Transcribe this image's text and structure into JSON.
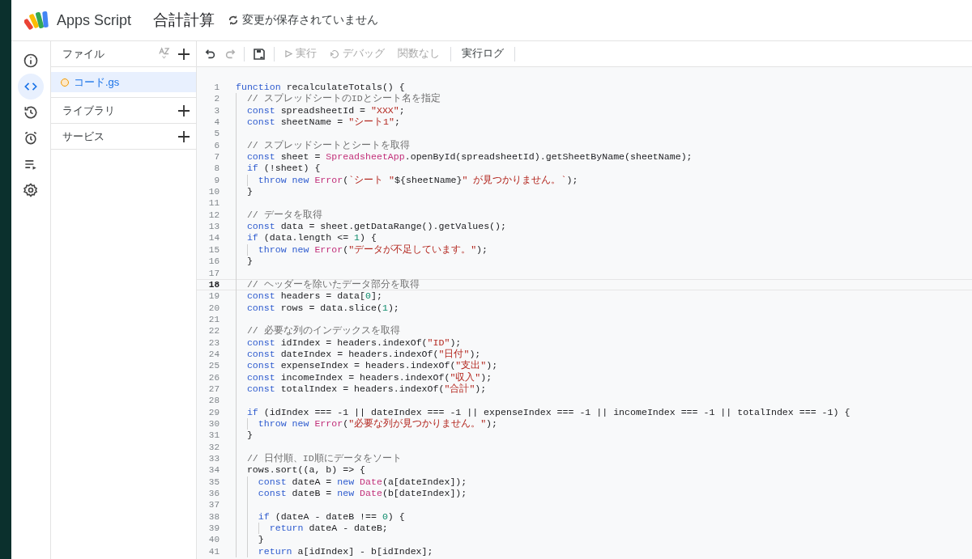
{
  "header": {
    "product": "Apps Script",
    "project": "合計計算",
    "status": "変更が保存されていません"
  },
  "rail": [
    {
      "kind": "info",
      "selected": false
    },
    {
      "kind": "code",
      "selected": true
    },
    {
      "kind": "history",
      "selected": false
    },
    {
      "kind": "alarm",
      "selected": false
    },
    {
      "kind": "executions",
      "selected": false
    },
    {
      "kind": "settings",
      "selected": false
    }
  ],
  "files_panel": {
    "title": "ファイル",
    "files": [
      {
        "name": "コード.gs",
        "selected": true,
        "unsaved": true
      }
    ],
    "sections": [
      "ライブラリ",
      "サービス"
    ]
  },
  "toolbar": [
    {
      "kind": "undo",
      "disabled": false
    },
    {
      "kind": "redo",
      "disabled": true
    },
    {
      "kind": "divider"
    },
    {
      "kind": "save",
      "disabled": false
    },
    {
      "kind": "divider"
    },
    {
      "kind": "run",
      "label": "実行",
      "disabled": true
    },
    {
      "kind": "debug",
      "label": "デバッグ",
      "disabled": true
    },
    {
      "kind": "select",
      "label": "関数なし",
      "disabled": true
    },
    {
      "kind": "divider"
    },
    {
      "kind": "text",
      "label": "実行ログ",
      "disabled": false
    },
    {
      "kind": "divider"
    }
  ],
  "code": [
    {
      "num": "1",
      "current": false,
      "tokens": [
        {
          "kind": "keyword",
          "text": "function"
        },
        {
          "kind": "plain",
          "text": " recalculateTotals() {"
        }
      ]
    },
    {
      "num": "2",
      "current": false,
      "tokens": [
        {
          "kind": "indent"
        },
        {
          "kind": "comment",
          "text": "// スプレッドシートのIDとシート名を指定"
        }
      ]
    },
    {
      "num": "3",
      "current": false,
      "tokens": [
        {
          "kind": "indent"
        },
        {
          "kind": "keyword",
          "text": "const"
        },
        {
          "kind": "plain",
          "text": " spreadsheetId = "
        },
        {
          "kind": "string",
          "text": "\"XXX\""
        },
        {
          "kind": "plain",
          "text": ";"
        }
      ]
    },
    {
      "num": "4",
      "current": false,
      "tokens": [
        {
          "kind": "indent"
        },
        {
          "kind": "keyword",
          "text": "const"
        },
        {
          "kind": "plain",
          "text": " sheetName = "
        },
        {
          "kind": "string",
          "text": "\"シート1\""
        },
        {
          "kind": "plain",
          "text": ";"
        }
      ]
    },
    {
      "num": "5",
      "current": false,
      "tokens": [
        {
          "kind": "indent"
        }
      ]
    },
    {
      "num": "6",
      "current": false,
      "tokens": [
        {
          "kind": "indent"
        },
        {
          "kind": "comment",
          "text": "// スプレッドシートとシートを取得"
        }
      ]
    },
    {
      "num": "7",
      "current": false,
      "tokens": [
        {
          "kind": "indent"
        },
        {
          "kind": "keyword",
          "text": "const"
        },
        {
          "kind": "plain",
          "text": " sheet = "
        },
        {
          "kind": "type",
          "text": "SpreadsheetApp"
        },
        {
          "kind": "plain",
          "text": ".openById(spreadsheetId).getSheetByName(sheetName);"
        }
      ]
    },
    {
      "num": "8",
      "current": false,
      "tokens": [
        {
          "kind": "indent"
        },
        {
          "kind": "keyword",
          "text": "if"
        },
        {
          "kind": "plain",
          "text": " (!sheet) {"
        }
      ]
    },
    {
      "num": "9",
      "current": false,
      "tokens": [
        {
          "kind": "indent"
        },
        {
          "kind": "indent"
        },
        {
          "kind": "keyword",
          "text": "throw"
        },
        {
          "kind": "keyword",
          "text": " new"
        },
        {
          "kind": "type",
          "text": " Error"
        },
        {
          "kind": "plain",
          "text": "("
        },
        {
          "kind": "string",
          "text": "`シート \""
        },
        {
          "kind": "plain",
          "text": "${sheetName}"
        },
        {
          "kind": "string",
          "text": "\" が見つかりません。`"
        },
        {
          "kind": "plain",
          "text": ");"
        }
      ]
    },
    {
      "num": "10",
      "current": false,
      "tokens": [
        {
          "kind": "indent"
        },
        {
          "kind": "plain",
          "text": "}"
        }
      ]
    },
    {
      "num": "11",
      "current": false,
      "tokens": [
        {
          "kind": "indent"
        }
      ]
    },
    {
      "num": "12",
      "current": false,
      "tokens": [
        {
          "kind": "indent"
        },
        {
          "kind": "comment",
          "text": "// データを取得"
        }
      ]
    },
    {
      "num": "13",
      "current": false,
      "tokens": [
        {
          "kind": "indent"
        },
        {
          "kind": "keyword",
          "text": "const"
        },
        {
          "kind": "plain",
          "text": " data = sheet.getDataRange().getValues();"
        }
      ]
    },
    {
      "num": "14",
      "current": false,
      "tokens": [
        {
          "kind": "indent"
        },
        {
          "kind": "keyword",
          "text": "if"
        },
        {
          "kind": "plain",
          "text": " (data.length <= "
        },
        {
          "kind": "number",
          "text": "1"
        },
        {
          "kind": "plain",
          "text": ") {"
        }
      ]
    },
    {
      "num": "15",
      "current": false,
      "tokens": [
        {
          "kind": "indent"
        },
        {
          "kind": "indent"
        },
        {
          "kind": "keyword",
          "text": "throw"
        },
        {
          "kind": "keyword",
          "text": " new"
        },
        {
          "kind": "type",
          "text": " Error"
        },
        {
          "kind": "plain",
          "text": "("
        },
        {
          "kind": "string",
          "text": "\"データが不足しています。\""
        },
        {
          "kind": "plain",
          "text": ");"
        }
      ]
    },
    {
      "num": "16",
      "current": false,
      "tokens": [
        {
          "kind": "indent"
        },
        {
          "kind": "plain",
          "text": "}"
        }
      ]
    },
    {
      "num": "17",
      "current": false,
      "tokens": [
        {
          "kind": "indent"
        }
      ]
    },
    {
      "num": "18",
      "current": true,
      "tokens": [
        {
          "kind": "indent"
        },
        {
          "kind": "comment",
          "text": "// ヘッダーを除いたデータ部分を取得"
        }
      ]
    },
    {
      "num": "19",
      "current": false,
      "tokens": [
        {
          "kind": "indent"
        },
        {
          "kind": "keyword",
          "text": "const"
        },
        {
          "kind": "plain",
          "text": " headers = data["
        },
        {
          "kind": "number",
          "text": "0"
        },
        {
          "kind": "plain",
          "text": "];"
        }
      ]
    },
    {
      "num": "20",
      "current": false,
      "tokens": [
        {
          "kind": "indent"
        },
        {
          "kind": "keyword",
          "text": "const"
        },
        {
          "kind": "plain",
          "text": " rows = data.slice("
        },
        {
          "kind": "number",
          "text": "1"
        },
        {
          "kind": "plain",
          "text": ");"
        }
      ]
    },
    {
      "num": "21",
      "current": false,
      "tokens": [
        {
          "kind": "indent"
        }
      ]
    },
    {
      "num": "22",
      "current": false,
      "tokens": [
        {
          "kind": "indent"
        },
        {
          "kind": "comment",
          "text": "// 必要な列のインデックスを取得"
        }
      ]
    },
    {
      "num": "23",
      "current": false,
      "tokens": [
        {
          "kind": "indent"
        },
        {
          "kind": "keyword",
          "text": "const"
        },
        {
          "kind": "plain",
          "text": " idIndex = headers.indexOf("
        },
        {
          "kind": "string",
          "text": "\"ID\""
        },
        {
          "kind": "plain",
          "text": ");"
        }
      ]
    },
    {
      "num": "24",
      "current": false,
      "tokens": [
        {
          "kind": "indent"
        },
        {
          "kind": "keyword",
          "text": "const"
        },
        {
          "kind": "plain",
          "text": " dateIndex = headers.indexOf("
        },
        {
          "kind": "string",
          "text": "\"日付\""
        },
        {
          "kind": "plain",
          "text": ");"
        }
      ]
    },
    {
      "num": "25",
      "current": false,
      "tokens": [
        {
          "kind": "indent"
        },
        {
          "kind": "keyword",
          "text": "const"
        },
        {
          "kind": "plain",
          "text": " expenseIndex = headers.indexOf("
        },
        {
          "kind": "string",
          "text": "\"支出\""
        },
        {
          "kind": "plain",
          "text": ");"
        }
      ]
    },
    {
      "num": "26",
      "current": false,
      "tokens": [
        {
          "kind": "indent"
        },
        {
          "kind": "keyword",
          "text": "const"
        },
        {
          "kind": "plain",
          "text": " incomeIndex = headers.indexOf("
        },
        {
          "kind": "string",
          "text": "\"収入\""
        },
        {
          "kind": "plain",
          "text": ");"
        }
      ]
    },
    {
      "num": "27",
      "current": false,
      "tokens": [
        {
          "kind": "indent"
        },
        {
          "kind": "keyword",
          "text": "const"
        },
        {
          "kind": "plain",
          "text": " totalIndex = headers.indexOf("
        },
        {
          "kind": "string",
          "text": "\"合計\""
        },
        {
          "kind": "plain",
          "text": ");"
        }
      ]
    },
    {
      "num": "28",
      "current": false,
      "tokens": [
        {
          "kind": "indent"
        }
      ]
    },
    {
      "num": "29",
      "current": false,
      "tokens": [
        {
          "kind": "indent"
        },
        {
          "kind": "keyword",
          "text": "if"
        },
        {
          "kind": "plain",
          "text": " (idIndex === -1 || dateIndex === -1 || expenseIndex === -1 || incomeIndex === -1 || totalIndex === -1) {"
        }
      ]
    },
    {
      "num": "30",
      "current": false,
      "tokens": [
        {
          "kind": "indent"
        },
        {
          "kind": "indent"
        },
        {
          "kind": "keyword",
          "text": "throw"
        },
        {
          "kind": "keyword",
          "text": " new"
        },
        {
          "kind": "type",
          "text": " Error"
        },
        {
          "kind": "plain",
          "text": "("
        },
        {
          "kind": "string",
          "text": "\"必要な列が見つかりません。\""
        },
        {
          "kind": "plain",
          "text": ");"
        }
      ]
    },
    {
      "num": "31",
      "current": false,
      "tokens": [
        {
          "kind": "indent"
        },
        {
          "kind": "plain",
          "text": "}"
        }
      ]
    },
    {
      "num": "32",
      "current": false,
      "tokens": [
        {
          "kind": "indent"
        }
      ]
    },
    {
      "num": "33",
      "current": false,
      "tokens": [
        {
          "kind": "indent"
        },
        {
          "kind": "comment",
          "text": "// 日付順、ID順にデータをソート"
        }
      ]
    },
    {
      "num": "34",
      "current": false,
      "tokens": [
        {
          "kind": "indent"
        },
        {
          "kind": "plain",
          "text": "rows.sort((a, b) => {"
        }
      ]
    },
    {
      "num": "35",
      "current": false,
      "tokens": [
        {
          "kind": "indent"
        },
        {
          "kind": "indent"
        },
        {
          "kind": "keyword",
          "text": "const"
        },
        {
          "kind": "plain",
          "text": " dateA ="
        },
        {
          "kind": "keyword",
          "text": " new"
        },
        {
          "kind": "type",
          "text": " Date"
        },
        {
          "kind": "plain",
          "text": "(a[dateIndex]);"
        }
      ]
    },
    {
      "num": "36",
      "current": false,
      "tokens": [
        {
          "kind": "indent"
        },
        {
          "kind": "indent"
        },
        {
          "kind": "keyword",
          "text": "const"
        },
        {
          "kind": "plain",
          "text": " dateB ="
        },
        {
          "kind": "keyword",
          "text": " new"
        },
        {
          "kind": "type",
          "text": " Date"
        },
        {
          "kind": "plain",
          "text": "(b[dateIndex]);"
        }
      ]
    },
    {
      "num": "37",
      "current": false,
      "tokens": [
        {
          "kind": "indent"
        },
        {
          "kind": "indent"
        }
      ]
    },
    {
      "num": "38",
      "current": false,
      "tokens": [
        {
          "kind": "indent"
        },
        {
          "kind": "indent"
        },
        {
          "kind": "keyword",
          "text": "if"
        },
        {
          "kind": "plain",
          "text": " (dateA - dateB !== "
        },
        {
          "kind": "number",
          "text": "0"
        },
        {
          "kind": "plain",
          "text": ") {"
        }
      ]
    },
    {
      "num": "39",
      "current": false,
      "tokens": [
        {
          "kind": "indent"
        },
        {
          "kind": "indent"
        },
        {
          "kind": "indent"
        },
        {
          "kind": "keyword",
          "text": "return"
        },
        {
          "kind": "plain",
          "text": " dateA - dateB;"
        }
      ]
    },
    {
      "num": "40",
      "current": false,
      "tokens": [
        {
          "kind": "indent"
        },
        {
          "kind": "indent"
        },
        {
          "kind": "plain",
          "text": "}"
        }
      ]
    },
    {
      "num": "41",
      "current": false,
      "tokens": [
        {
          "kind": "indent"
        },
        {
          "kind": "indent"
        },
        {
          "kind": "keyword",
          "text": "return"
        },
        {
          "kind": "plain",
          "text": " a[idIndex] - b[idIndex];"
        }
      ]
    }
  ]
}
